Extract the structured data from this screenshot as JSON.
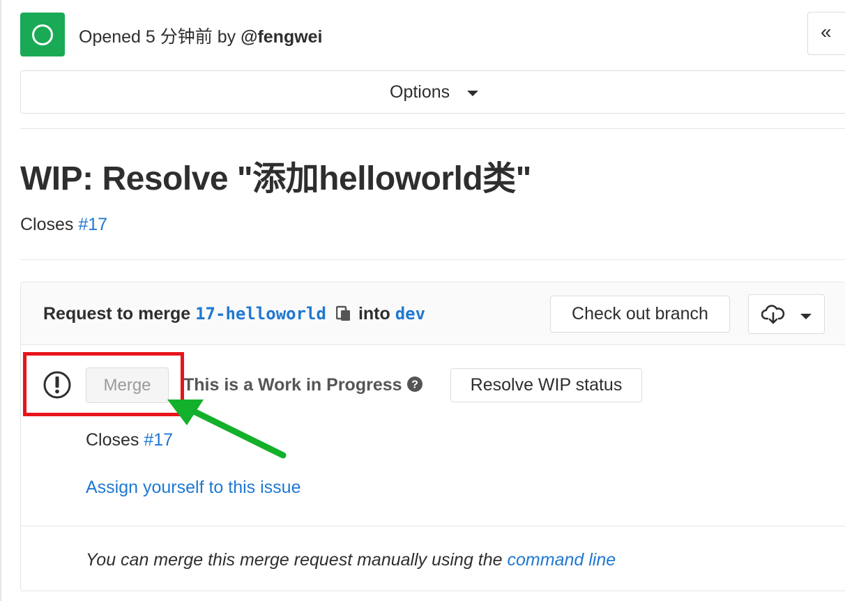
{
  "header": {
    "opened_prefix": "Opened 5 分钟前 by ",
    "author": "@fengwei",
    "collapse_label": "«",
    "status_color": "#1aaa55"
  },
  "options": {
    "label": "Options"
  },
  "mr": {
    "title": "WIP: Resolve \"添加helloworld类\"",
    "closes_label": "Closes ",
    "closes_issue": "#17"
  },
  "widget": {
    "request_label": "Request to merge ",
    "source_branch": "17-helloworld",
    "into_label": "into ",
    "target_branch": "dev",
    "checkout_label": "Check out branch",
    "merge_label": "Merge",
    "wip_text": "This is a Work in Progress",
    "resolve_label": "Resolve WIP status",
    "closes_label": "Closes ",
    "closes_issue": "#17",
    "assign_link": "Assign yourself to this issue",
    "cmd_prefix": "You can merge this merge request manually using the ",
    "cmd_link": "command line"
  },
  "annotation": {
    "highlight_color": "#e8141b",
    "arrow_color": "#13b02b"
  },
  "icons": {
    "status": "status-open-icon",
    "copy": "clipboard-icon",
    "download": "cloud-download-icon",
    "warning": "warning-icon",
    "help": "question-circle-icon"
  }
}
